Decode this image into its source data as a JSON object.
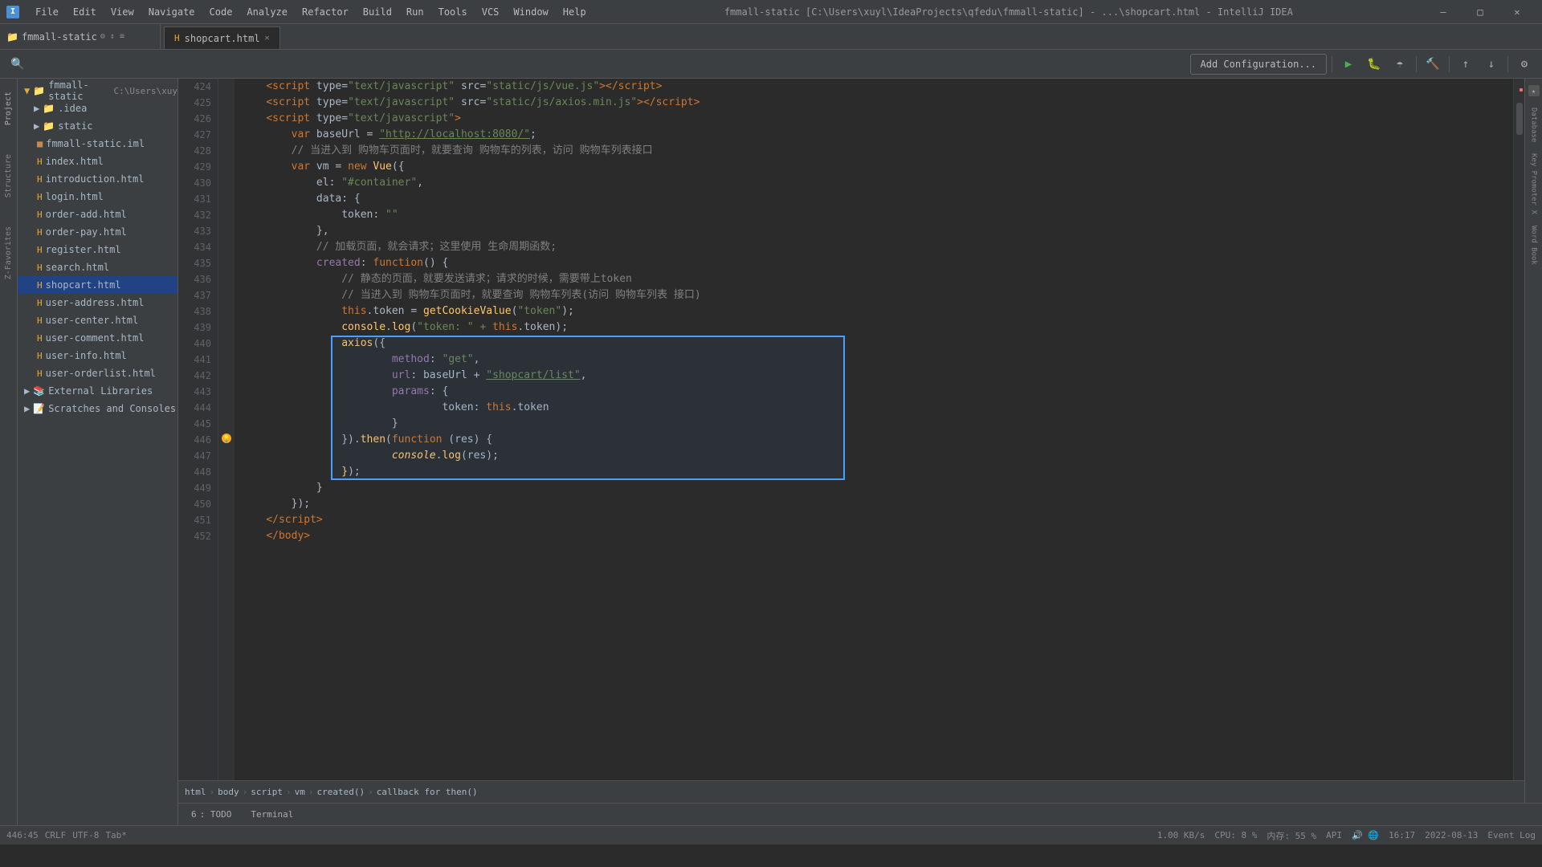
{
  "titleBar": {
    "appIcon": "I",
    "menus": [
      "File",
      "Edit",
      "View",
      "Navigate",
      "Code",
      "Analyze",
      "Refactor",
      "Build",
      "Run",
      "Tools",
      "VCS",
      "Window",
      "Help"
    ],
    "title": "fmmall-static [C:\\Users\\xuyl\\IdeaProjects\\qfedu\\fmmall-static] - ...\\shopcart.html - IntelliJ IDEA",
    "windowBtns": [
      "—",
      "□",
      "✕"
    ]
  },
  "tabBar": {
    "projectName": "fmmall-static",
    "tabs": [
      {
        "name": "shopcart.html",
        "active": true
      }
    ]
  },
  "toolbar": {
    "runConfigLabel": "Add Configuration...",
    "icons": [
      "▶",
      "⏸",
      "⏹",
      "🔨",
      "🐛"
    ]
  },
  "sidebar": {
    "header": "Project",
    "projectRoot": "fmmall-static",
    "projectPath": "C:\\Users\\xuy",
    "items": [
      {
        "label": ".idea",
        "type": "folder",
        "indent": 1
      },
      {
        "label": "static",
        "type": "folder",
        "indent": 1
      },
      {
        "label": "fmmall-static.iml",
        "type": "iml",
        "indent": 1
      },
      {
        "label": "index.html",
        "type": "html",
        "indent": 1
      },
      {
        "label": "introduction.html",
        "type": "html",
        "indent": 1
      },
      {
        "label": "login.html",
        "type": "html",
        "indent": 1
      },
      {
        "label": "order-add.html",
        "type": "html",
        "indent": 1
      },
      {
        "label": "order-pay.html",
        "type": "html",
        "indent": 1
      },
      {
        "label": "register.html",
        "type": "html",
        "indent": 1
      },
      {
        "label": "search.html",
        "type": "html",
        "indent": 1
      },
      {
        "label": "shopcart.html",
        "type": "html",
        "indent": 1,
        "selected": true
      },
      {
        "label": "user-address.html",
        "type": "html",
        "indent": 1
      },
      {
        "label": "user-center.html",
        "type": "html",
        "indent": 1
      },
      {
        "label": "user-comment.html",
        "type": "html",
        "indent": 1
      },
      {
        "label": "user-info.html",
        "type": "html",
        "indent": 1
      },
      {
        "label": "user-orderlist.html",
        "type": "html",
        "indent": 1
      },
      {
        "label": "External Libraries",
        "type": "folder",
        "indent": 0
      },
      {
        "label": "Scratches and Consoles",
        "type": "folder",
        "indent": 0
      }
    ]
  },
  "editor": {
    "lines": [
      {
        "num": 424,
        "content": "script_vue"
      },
      {
        "num": 425,
        "content": "script_axios"
      },
      {
        "num": 426,
        "content": "script_open"
      },
      {
        "num": 427,
        "content": "var_baseUrl"
      },
      {
        "num": 428,
        "content": "comment_cart"
      },
      {
        "num": 429,
        "content": "var_vm"
      },
      {
        "num": 430,
        "content": "el"
      },
      {
        "num": 431,
        "content": "data_open"
      },
      {
        "num": 432,
        "content": "token"
      },
      {
        "num": 433,
        "content": "data_close"
      },
      {
        "num": 434,
        "content": "comment_load"
      },
      {
        "num": 435,
        "content": "created"
      },
      {
        "num": 436,
        "content": "comment_static"
      },
      {
        "num": 437,
        "content": "comment_cart2"
      },
      {
        "num": 438,
        "content": "this_token"
      },
      {
        "num": 439,
        "content": "console_log"
      },
      {
        "num": 440,
        "content": "axios_open"
      },
      {
        "num": 441,
        "content": "method"
      },
      {
        "num": 442,
        "content": "url"
      },
      {
        "num": 443,
        "content": "params_open"
      },
      {
        "num": 444,
        "content": "token_this"
      },
      {
        "num": 445,
        "content": "brace_close"
      },
      {
        "num": 446,
        "content": "then"
      },
      {
        "num": 447,
        "content": "console_res"
      },
      {
        "num": 448,
        "content": "then_close"
      },
      {
        "num": 449,
        "content": "brace_close2"
      },
      {
        "num": 450,
        "content": "script_close_tag"
      },
      {
        "num": 451,
        "content": "script_end"
      },
      {
        "num": 452,
        "content": "body_close"
      }
    ]
  },
  "breadcrumb": {
    "items": [
      "html",
      "body",
      "script",
      "vm",
      "created()",
      "callback for then()"
    ]
  },
  "statusBar": {
    "left": [
      "6: TODO",
      "Terminal"
    ],
    "position": "446:45",
    "encoding": "CRLF",
    "charset": "UTF-8",
    "indent": "Tab*",
    "network": "1.00 KB/s",
    "memory": "内存: 55 %",
    "cpu": "CPU: 8 %",
    "api": "API",
    "time": "16:17",
    "date": "2022-08-13",
    "eventLog": "Event Log"
  }
}
